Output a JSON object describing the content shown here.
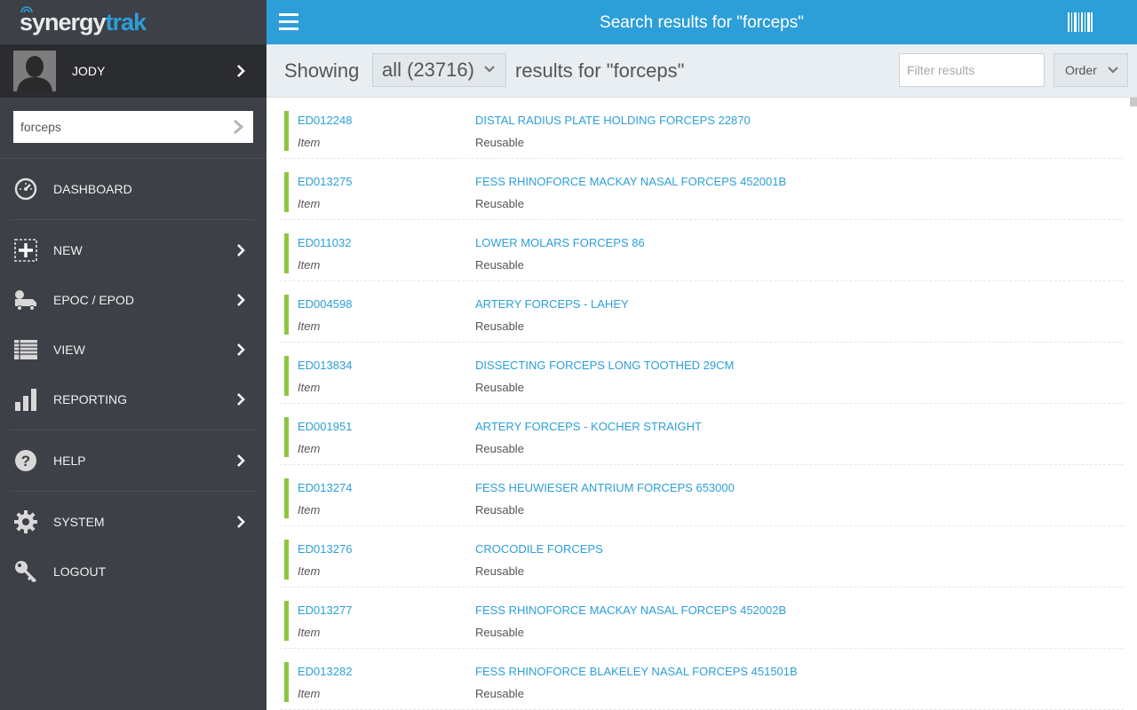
{
  "brand": {
    "logo_part1": "synergy",
    "logo_part2": "trak"
  },
  "user": {
    "name": "JODY"
  },
  "search": {
    "value": "forceps"
  },
  "nav": [
    {
      "label": "DASHBOARD",
      "icon": "dashboard-icon"
    },
    {
      "label": "NEW",
      "icon": "plus-icon"
    },
    {
      "label": "EPOC / EPOD",
      "icon": "truck-icon"
    },
    {
      "label": "VIEW",
      "icon": "list-icon"
    },
    {
      "label": "REPORTING",
      "icon": "bar-chart-icon"
    },
    {
      "label": "HELP",
      "icon": "help-icon"
    },
    {
      "label": "SYSTEM",
      "icon": "gear-icon"
    },
    {
      "label": "LOGOUT",
      "icon": "key-icon"
    }
  ],
  "header": {
    "title": "Search results for \"forceps\""
  },
  "subheader": {
    "showing": "Showing",
    "scope": "all (23716)",
    "results_for": "results for \"forceps\"",
    "filter_placeholder": "Filter results",
    "order_label": "Order"
  },
  "results": [
    {
      "code": "ED012248",
      "type": "Item",
      "description": "DISTAL RADIUS PLATE HOLDING FORCEPS 22870",
      "status": "Reusable"
    },
    {
      "code": "ED013275",
      "type": "Item",
      "description": "FESS RHINOFORCE MACKAY NASAL FORCEPS 452001B",
      "status": "Reusable"
    },
    {
      "code": "ED011032",
      "type": "Item",
      "description": "LOWER MOLARS FORCEPS 86",
      "status": "Reusable"
    },
    {
      "code": "ED004598",
      "type": "Item",
      "description": "ARTERY FORCEPS - LAHEY",
      "status": "Reusable"
    },
    {
      "code": "ED013834",
      "type": "Item",
      "description": "DISSECTING FORCEPS LONG TOOTHED 29CM",
      "status": "Reusable"
    },
    {
      "code": "ED001951",
      "type": "Item",
      "description": "ARTERY FORCEPS - KOCHER STRAIGHT",
      "status": "Reusable"
    },
    {
      "code": "ED013274",
      "type": "Item",
      "description": "FESS HEUWIESER ANTRIUM FORCEPS 653000",
      "status": "Reusable"
    },
    {
      "code": "ED013276",
      "type": "Item",
      "description": "CROCODILE FORCEPS",
      "status": "Reusable"
    },
    {
      "code": "ED013277",
      "type": "Item",
      "description": "FESS RHINOFORCE MACKAY NASAL FORCEPS 452002B",
      "status": "Reusable"
    },
    {
      "code": "ED013282",
      "type": "Item",
      "description": "FESS RHINOFORCE BLAKELEY NASAL FORCEPS 451501B",
      "status": "Reusable"
    }
  ],
  "colors": {
    "sidebar": "#3d4047",
    "accent": "#2d9fd8",
    "status_bar": "#8cc63f"
  }
}
